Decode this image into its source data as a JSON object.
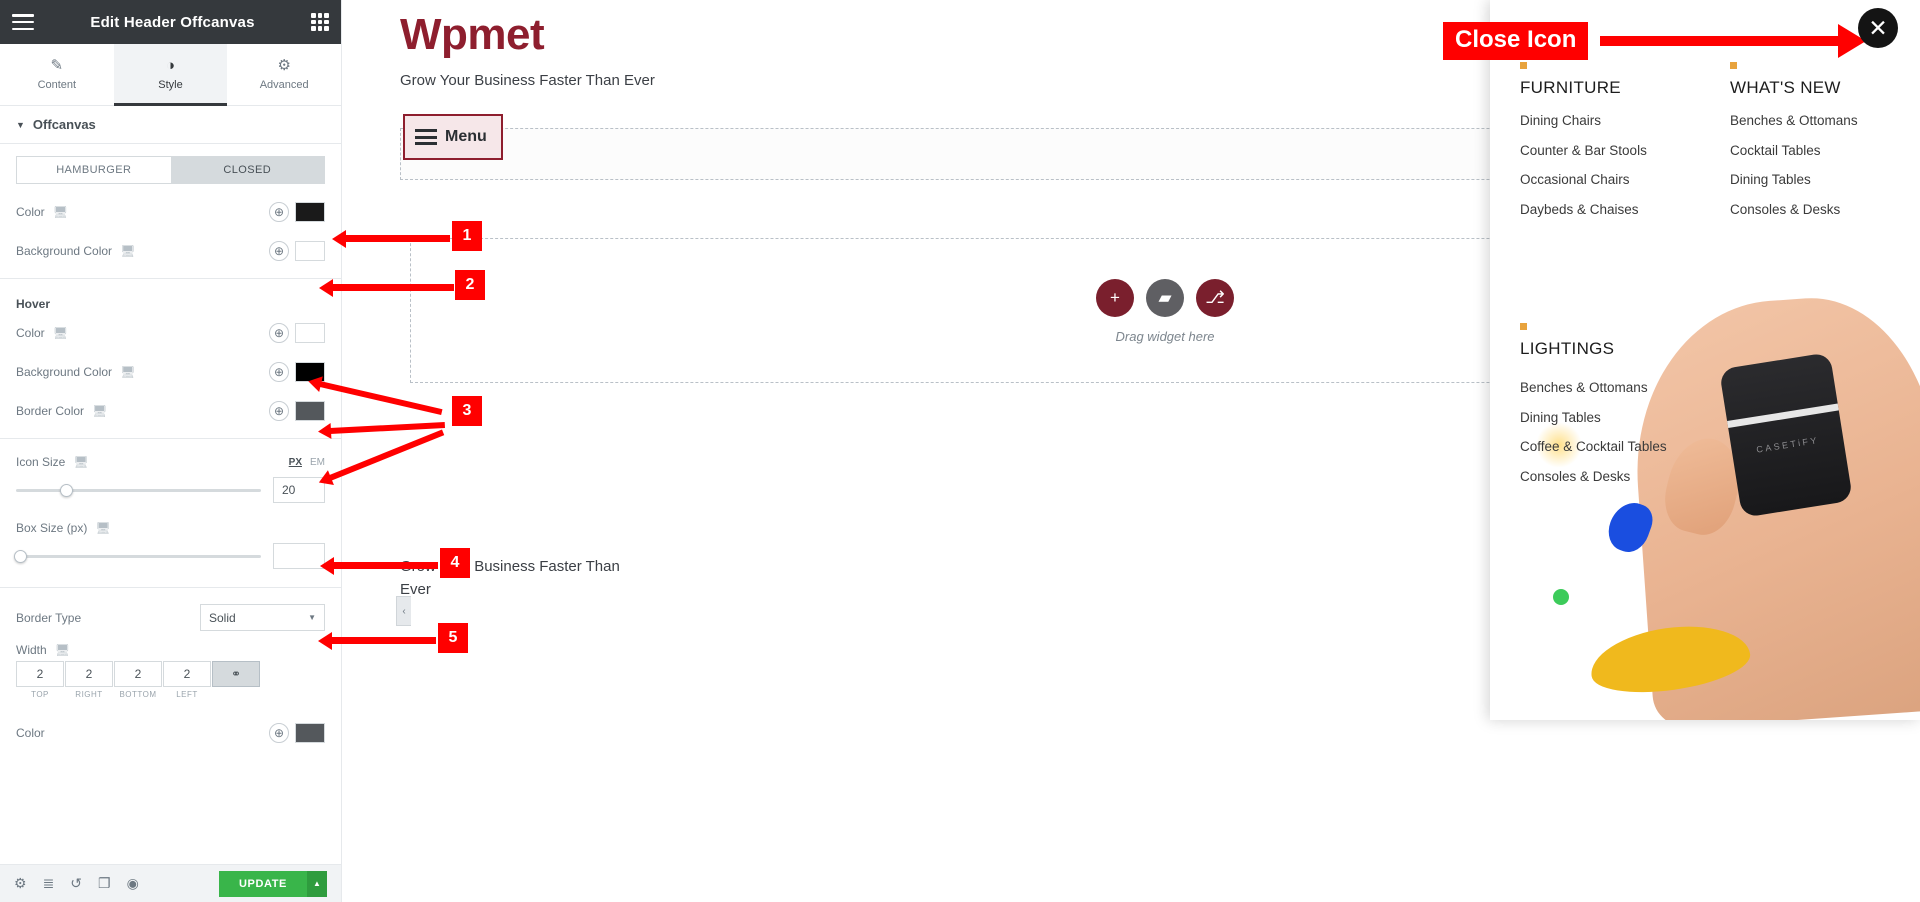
{
  "panel": {
    "title": "Edit Header Offcanvas",
    "menu_icon": "hamburger-icon",
    "grid_icon": "grid-icon",
    "tabs": [
      {
        "label": "Content",
        "icon": "pencil-icon",
        "glyph": "✎",
        "active": false
      },
      {
        "label": "Style",
        "icon": "contrast-circle-icon",
        "glyph": "◑",
        "active": true
      },
      {
        "label": "Advanced",
        "icon": "gear-icon",
        "glyph": "⚙",
        "active": false
      }
    ],
    "section": {
      "label": "Offcanvas",
      "caret": "▼"
    },
    "state_toggle": {
      "options": [
        "HAMBURGER",
        "CLOSED"
      ],
      "selected": "CLOSED"
    },
    "normal": [
      {
        "label": "Color",
        "responsive_icon": "monitor-icon",
        "globe": "⊕",
        "swatch": "#1a1a1a"
      },
      {
        "label": "Background Color",
        "responsive_icon": "monitor-icon",
        "globe": "⊕",
        "swatch": "#ffffff"
      }
    ],
    "hover_heading": "Hover",
    "hover": [
      {
        "label": "Color",
        "responsive_icon": "monitor-icon",
        "globe": "⊕",
        "swatch": "#ffffff"
      },
      {
        "label": "Background Color",
        "responsive_icon": "monitor-icon",
        "globe": "⊕",
        "swatch": "#000000"
      },
      {
        "label": "Border Color",
        "responsive_icon": "monitor-icon",
        "globe": "⊕",
        "swatch": "#54585c"
      }
    ],
    "icon_size": {
      "label": "Icon Size",
      "responsive_icon": "monitor-icon",
      "units": [
        "PX",
        "EM"
      ],
      "unit_selected": "PX",
      "value": "20",
      "knob_percent": 20
    },
    "box_size": {
      "label": "Box Size (px)",
      "responsive_icon": "monitor-icon",
      "value": "",
      "knob_percent": 0
    },
    "border_type": {
      "label": "Border Type",
      "value": "Solid",
      "arrow": "▼"
    },
    "width": {
      "label": "Width",
      "responsive_icon": "monitor-icon",
      "values": [
        "2",
        "2",
        "2",
        "2"
      ],
      "captions": [
        "TOP",
        "RIGHT",
        "BOTTOM",
        "LEFT"
      ],
      "link_icon": "link-icon",
      "link_glyph": "⚭"
    },
    "border_color": {
      "label": "Color",
      "globe": "⊕",
      "swatch": "#54585c"
    },
    "footer": {
      "icons": [
        {
          "name": "settings-gear-icon",
          "glyph": "⚙"
        },
        {
          "name": "layers-icon",
          "glyph": "≣"
        },
        {
          "name": "history-icon",
          "glyph": "↺"
        },
        {
          "name": "responsive-mode-icon",
          "glyph": "❐"
        },
        {
          "name": "preview-eye-icon",
          "glyph": "◉"
        }
      ],
      "update_label": "UPDATE",
      "update_caret": "▲"
    }
  },
  "canvas": {
    "site_title": "Wpmet",
    "site_sub": "Grow Your Business Faster Than Ever",
    "menu_button": "Menu",
    "drag_text": "Drag widget here",
    "widget_icons": [
      {
        "name": "add-widget-icon",
        "glyph": "+"
      },
      {
        "name": "folder-icon",
        "glyph": "▰"
      },
      {
        "name": "template-icon",
        "glyph": "⎇"
      }
    ],
    "bottom_text": "Grow Your Business Faster Than Ever",
    "collapse_handle": "‹"
  },
  "offcanvas": {
    "close_icon": "✕",
    "columns": [
      {
        "heading": "FURNITURE",
        "items": [
          "Dining Chairs",
          "Counter & Bar Stools",
          "Occasional Chairs",
          "Daybeds & Chaises"
        ]
      },
      {
        "heading": "WHAT'S NEW",
        "items": [
          "Benches & Ottomans",
          "Cocktail Tables",
          "Dining Tables",
          "Consoles & Desks"
        ]
      }
    ],
    "section2": {
      "heading": "LIGHTINGS",
      "items": [
        "Benches & Ottomans",
        "Dining Tables",
        "Coffee & Cocktail Tables",
        "Consoles & Desks"
      ]
    },
    "brand_text": "CASETiFY"
  },
  "annotations": {
    "close_label": "Close Icon",
    "numbers": [
      "1",
      "2",
      "3",
      "4",
      "5"
    ],
    "color": "#ff0000"
  }
}
